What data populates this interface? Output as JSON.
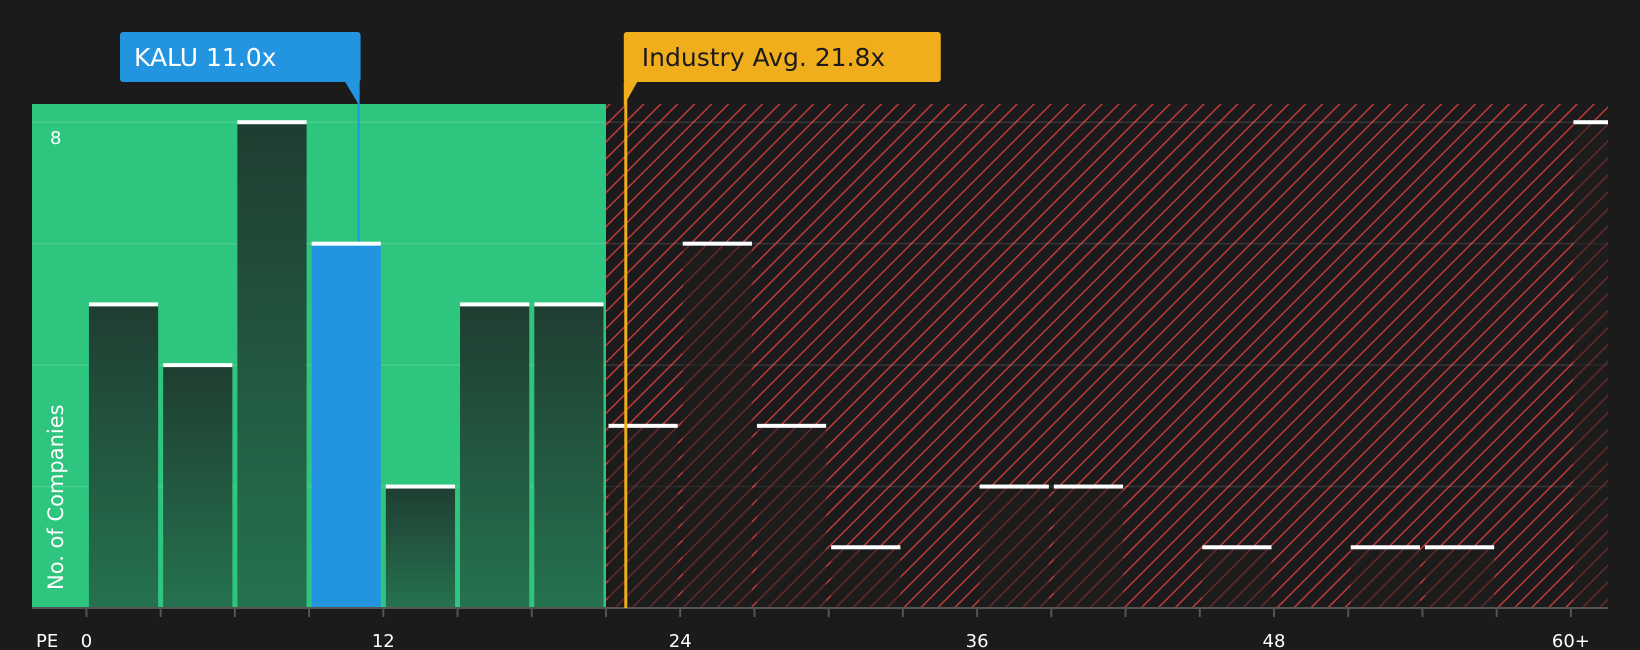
{
  "chart_data": {
    "type": "bar",
    "x_axis_label": "PE",
    "y_axis_label": "No. of Companies",
    "x_ticks": [
      "0",
      "12",
      "24",
      "36",
      "48",
      "60+"
    ],
    "x_tick_values": [
      0,
      12,
      24,
      36,
      48,
      60
    ],
    "y_ticks": [
      "8"
    ],
    "y_tick_values": [
      8
    ],
    "ylim": [
      0,
      8.3
    ],
    "xlim": [
      -2.2,
      61.5
    ],
    "bin_width": 3,
    "bins": [
      {
        "start": 0,
        "count": 5,
        "highlight": true
      },
      {
        "start": 3,
        "count": 4
      },
      {
        "start": 6,
        "count": 8
      },
      {
        "start": 9,
        "count": 6,
        "subject": true
      },
      {
        "start": 12,
        "count": 2
      },
      {
        "start": 15,
        "count": 5
      },
      {
        "start": 18,
        "count": 5
      },
      {
        "start": 21,
        "count": 3
      },
      {
        "start": 24,
        "count": 6
      },
      {
        "start": 27,
        "count": 3
      },
      {
        "start": 30,
        "count": 1
      },
      {
        "start": 33,
        "count": 0
      },
      {
        "start": 36,
        "count": 2
      },
      {
        "start": 39,
        "count": 2
      },
      {
        "start": 42,
        "count": 0
      },
      {
        "start": 45,
        "count": 1
      },
      {
        "start": 48,
        "count": 0
      },
      {
        "start": 51,
        "count": 1
      },
      {
        "start": 54,
        "count": 1
      },
      {
        "start": 57,
        "count": 0
      },
      {
        "start": 60,
        "count": 8
      }
    ],
    "subject": {
      "label": "KALU 11.0x",
      "value": 11.0
    },
    "industry_avg": {
      "label": "Industry Avg. 21.8x",
      "value": 21.8
    },
    "undervalued_region": [
      -2.2,
      21.0
    ],
    "overvalued_region": [
      21.0,
      61.5
    ],
    "grid": true,
    "colors": {
      "background": "#1b1b1b",
      "green_zone": "#2ec67e",
      "red_hatch": "#c0393b",
      "dark_bar": "#214234",
      "subject_bar": "#2394e0",
      "industry_line": "#f0ad1c",
      "bar_top": "#ffffff"
    }
  }
}
